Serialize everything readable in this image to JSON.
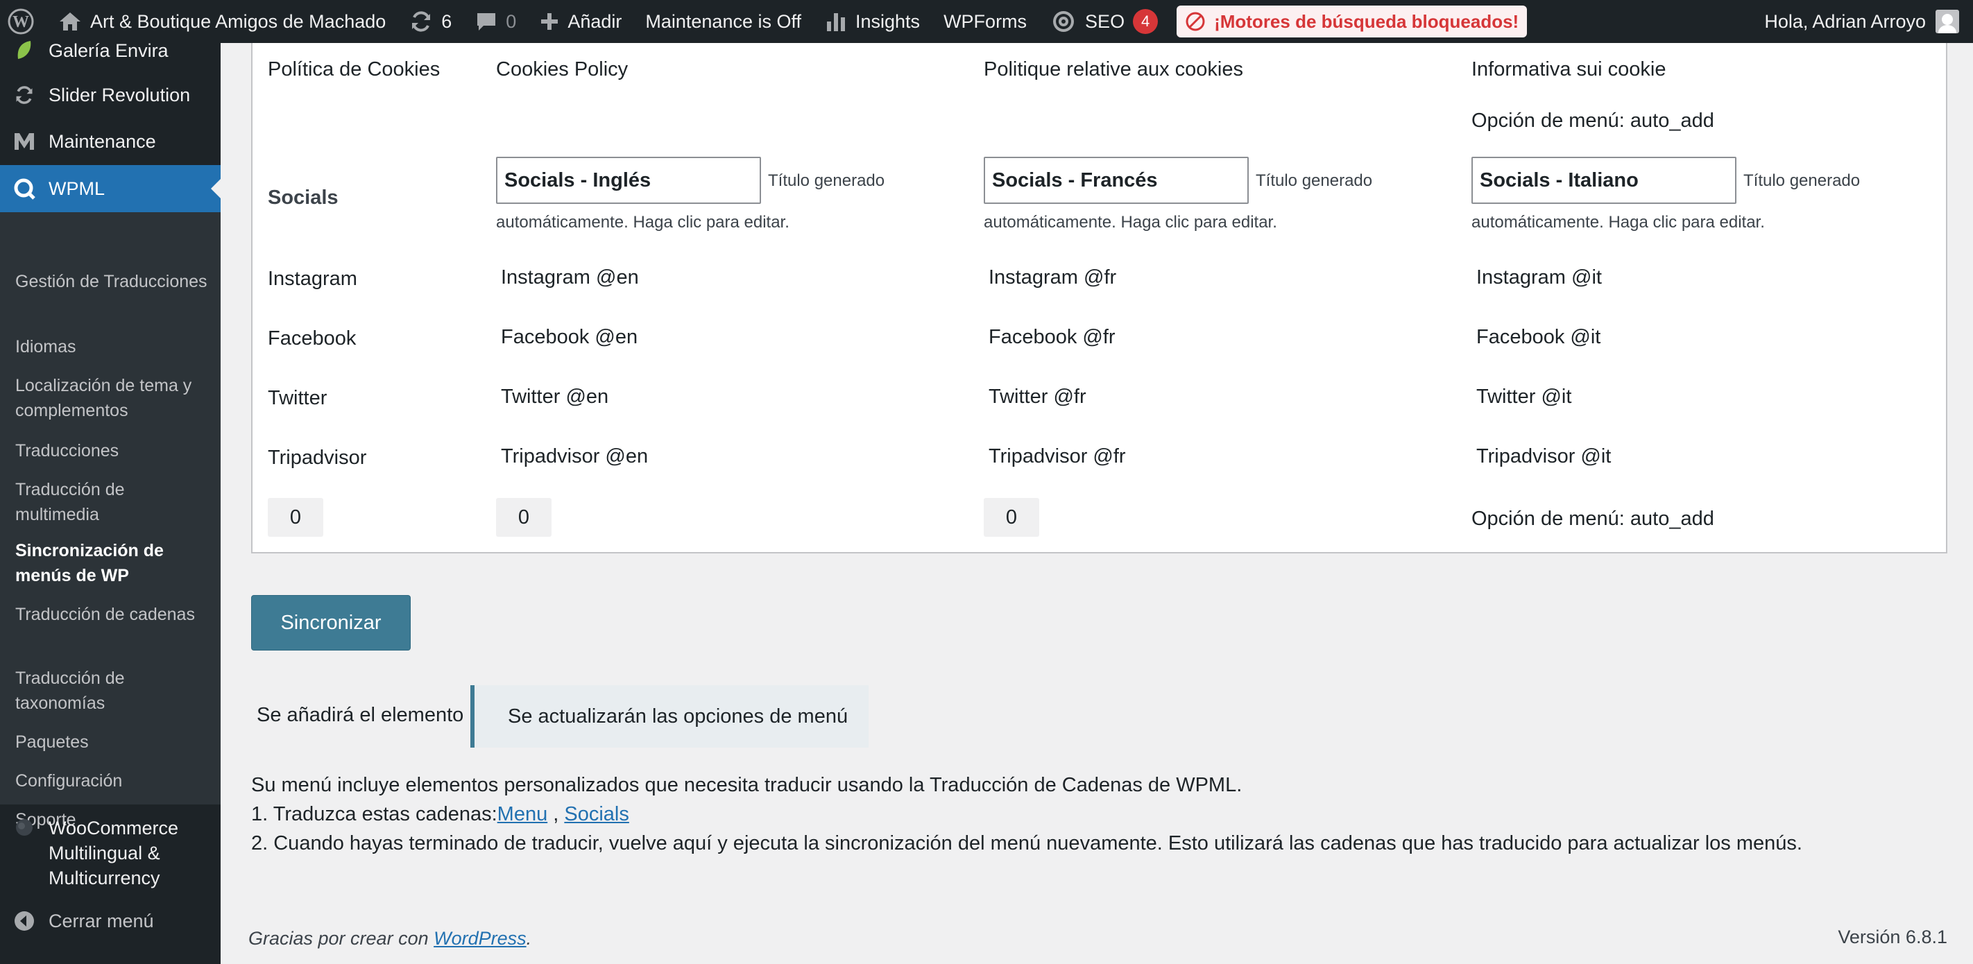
{
  "adminbar": {
    "site_name": "Art & Boutique Amigos de Machado",
    "updates_count": "6",
    "comments_count": "0",
    "add_new": "Añadir",
    "maintenance": "Maintenance is Off",
    "insights": "Insights",
    "wpforms": "WPForms",
    "seo": "SEO",
    "seo_badge": "4",
    "search_blocked": "¡Motores de búsqueda bloqueados!",
    "greeting": "Hola, Adrian Arroyo",
    "icons": [
      "wordpress-logo-icon",
      "home-icon",
      "refresh-icon",
      "comment-icon",
      "plus-icon",
      "bar-chart-icon",
      "gear-icon",
      "blocked-icon"
    ]
  },
  "sidebar": {
    "top_items": [
      {
        "label": "Galería Envira",
        "icon": "leaf-icon"
      },
      {
        "label": "Slider Revolution",
        "icon": "refresh-icon"
      },
      {
        "label": "Maintenance",
        "icon": "m-logo-icon"
      },
      {
        "label": "WPML",
        "icon": "wpml-icon"
      }
    ],
    "submenu": [
      "Gestión de Traducciones",
      "Idiomas",
      "Localización de tema y complementos",
      "Traducciones",
      "Traducción de multimedia",
      "Sincronización de menús de WP",
      "Traducción de cadenas",
      "Traducción de taxonomías",
      "Paquetes",
      "Configuración",
      "Soporte"
    ],
    "woocommerce": "WooCommerce Multilingual & Multicurrency",
    "collapse": "Cerrar menú"
  },
  "sync_table": {
    "row_cookies": {
      "label": "Política de Cookies",
      "en": "Cookies Policy",
      "fr": "Politique relative aux cookies",
      "it": "Informativa sui cookie",
      "it_option": "Opción de menú: auto_add"
    },
    "row_socials": {
      "label": "Socials",
      "en_value": "Socials - Inglés",
      "fr_value": "Socials - Francés",
      "it_value": "Socials - Italiano",
      "hint_1": "Título generado",
      "hint_2": "automáticamente. Haga clic para editar."
    },
    "items": [
      {
        "label": "Instagram",
        "en": "Instagram @en",
        "fr": "Instagram @fr",
        "it": "Instagram @it"
      },
      {
        "label": "Facebook",
        "en": "Facebook @en",
        "fr": "Facebook @fr",
        "it": "Facebook @it"
      },
      {
        "label": "Twitter",
        "en": "Twitter @en",
        "fr": "Twitter @fr",
        "it": "Twitter @it"
      },
      {
        "label": "Tripadvisor",
        "en": "Tripadvisor @en",
        "fr": "Tripadvisor @fr",
        "it": "Tripadvisor @it"
      }
    ],
    "counts": {
      "default": "0",
      "en": "0",
      "fr": "0"
    },
    "it_footer_option": "Opción de menú: auto_add"
  },
  "actions": {
    "sync_button": "Sincronizar",
    "legend_add": "Se añadirá el elemento",
    "legend_update": "Se actualizarán las opciones de menú"
  },
  "notice": {
    "line1": "Su menú incluye elementos personalizados que necesita traducir usando la Traducción de Cadenas de WPML.",
    "line2_prefix": "1. Traduzca estas cadenas:",
    "link_menu": "Menu",
    "separator": " , ",
    "link_socials": "Socials",
    "line3": "2. Cuando hayas terminado de traducir, vuelve aquí y ejecuta la sincronización del menú nuevamente. Esto utilizará las cadenas que has traducido para actualizar los menús."
  },
  "footer": {
    "thanks_prefix": "Gracias por crear con ",
    "wordpress_link": "WordPress",
    "thanks_suffix": ".",
    "version": "Versión 6.8.1"
  }
}
